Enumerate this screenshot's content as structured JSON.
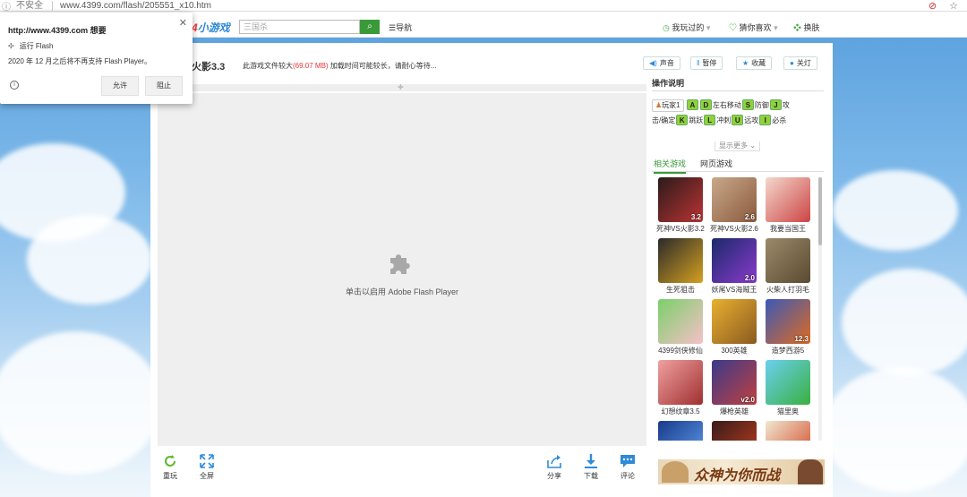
{
  "browser": {
    "insecure_label": "不安全",
    "url": "www.4399.com/flash/205551_x10.htm"
  },
  "nav": {
    "logo_suffix": "小游戏",
    "search_placeholder": "三国杀",
    "menu_label": "☰导航",
    "played": "我玩过的",
    "guess": "猜你喜欢",
    "skin": "换肤"
  },
  "game": {
    "title": "火影3.3",
    "load_tip_prefix": "此游戏文件较大",
    "file_size": "(69.07 MB)",
    "load_tip_suffix": "加载时间可能较长，请耐心等待...",
    "buttons": {
      "sound": "声音",
      "pause": "暂停",
      "favorite": "收藏",
      "lights": "关灯"
    },
    "flash_prompt": "单击以启用 Adobe Flash Player",
    "bottom": {
      "replay": "重玩",
      "fullscreen": "全屏",
      "share": "分享",
      "download": "下载",
      "comment": "评论"
    }
  },
  "controls": {
    "heading": "操作说明",
    "player": "玩家1",
    "keys": {
      "a": "A",
      "d": "D",
      "s": "S",
      "j": "J",
      "k": "K",
      "l": "L",
      "i": "I",
      "u": "U",
      "t": "T"
    },
    "labels": {
      "move": "左右移动",
      "defend": "防御",
      "attack_prefix": "攻",
      "attack_suffix": "击/确定",
      "jump": "跳跃",
      "dash": "冲刺",
      "ranged": "远攻",
      "ultimate": "必杀"
    },
    "show_more": "显示更多"
  },
  "tabs": {
    "related": "相关游戏",
    "webgames": "网页游戏"
  },
  "games": [
    {
      "name": "死神VS火影3.2",
      "badge": "3.2",
      "color1": "#2b1b1b",
      "color2": "#b33"
    },
    {
      "name": "死神VS火影2.6",
      "badge": "2.6",
      "color1": "#c9a88a",
      "color2": "#8b5a3c"
    },
    {
      "name": "我要当国王",
      "badge": "",
      "color1": "#f4d8cc",
      "color2": "#c44"
    },
    {
      "name": "生死狙击",
      "badge": "",
      "color1": "#2a2a2a",
      "color2": "#d4a020"
    },
    {
      "name": "妖尾VS海贼王",
      "badge": "2.0",
      "color1": "#1a2a6a",
      "color2": "#8a3acd"
    },
    {
      "name": "火柴人打羽毛",
      "badge": "",
      "color1": "#9b8a6a",
      "color2": "#5a4a30"
    },
    {
      "name": "4399剑侠修仙",
      "badge": "",
      "color1": "#7ad06a",
      "color2": "#f7c0c8"
    },
    {
      "name": "300英雄",
      "badge": "",
      "color1": "#e8b030",
      "color2": "#8a5a20"
    },
    {
      "name": "造梦西游5",
      "badge": "12.3",
      "color1": "#3a5ab8",
      "color2": "#e06a20"
    },
    {
      "name": "幻想纹章3.5",
      "badge": "",
      "color1": "#f0a0a0",
      "color2": "#a03030"
    },
    {
      "name": "爆枪英雄",
      "badge": "v2.0",
      "color1": "#3a3a8a",
      "color2": "#c04040"
    },
    {
      "name": "猫里奥",
      "badge": "",
      "color1": "#6ad0f0",
      "color2": "#3ab040"
    },
    {
      "name": "",
      "badge": "",
      "color1": "#1a3a8a",
      "color2": "#60a0f0"
    },
    {
      "name": "",
      "badge": "",
      "color1": "#3a1a1a",
      "color2": "#c04020"
    },
    {
      "name": "",
      "badge": "",
      "color1": "#f0e8d0",
      "color2": "#d04020"
    }
  ],
  "banner": {
    "text": "众神为你而战"
  },
  "popup": {
    "site": "http://www.4399.com 想要",
    "item1": "运行 Flash",
    "item2": "2020 年 12 月之后将不再支持 Flash Player。",
    "allow": "允许",
    "block": "阻止"
  }
}
